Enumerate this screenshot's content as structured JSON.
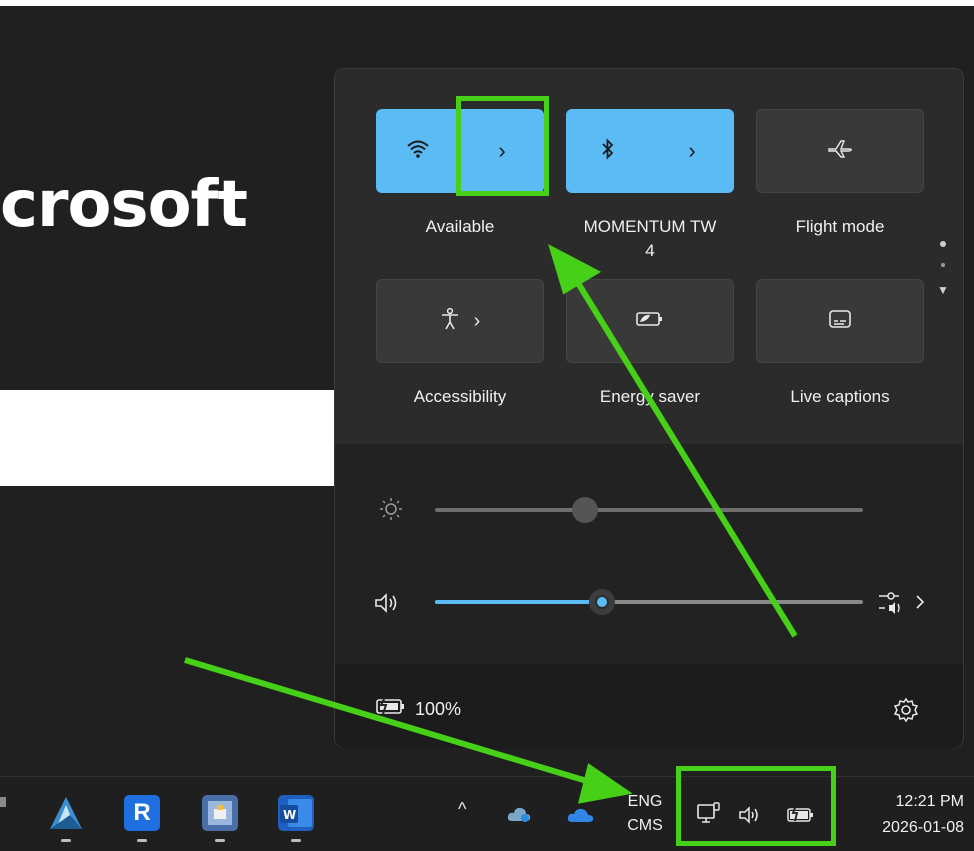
{
  "background": {
    "partial_title": "crosoft"
  },
  "quick_settings": {
    "tiles": [
      {
        "label": "Available",
        "icon": "wifi-icon",
        "state": "on",
        "has_chevron": true
      },
      {
        "label": "MOMENTUM TW\n4",
        "icon": "bluetooth-icon",
        "state": "on",
        "has_chevron": true
      },
      {
        "label": "Flight mode",
        "icon": "airplane-icon",
        "state": "off",
        "has_chevron": false
      },
      {
        "label": "Accessibility",
        "icon": "accessibility-icon",
        "state": "off",
        "has_chevron": true
      },
      {
        "label": "Energy saver",
        "icon": "energy-saver-icon",
        "state": "off",
        "has_chevron": false
      },
      {
        "label": "Live captions",
        "icon": "live-captions-icon",
        "state": "off",
        "has_chevron": false
      }
    ],
    "brightness": {
      "icon": "brightness-icon",
      "level": 0.35
    },
    "volume": {
      "icon": "speaker-icon",
      "level": 0.39,
      "mixer_icon": "audio-mixer-icon"
    },
    "battery": {
      "icon": "battery-charging-icon",
      "text": "100%"
    },
    "settings_icon": "gear-icon"
  },
  "taskbar": {
    "apps": [
      "arc-app-icon",
      "r-app-icon",
      "files-app-icon",
      "word-app-icon"
    ],
    "tray": {
      "language_line1": "ENG",
      "language_line2": "CMS",
      "time": "12:21 PM",
      "date": "2026-01-08"
    }
  },
  "colors": {
    "accent": "#5bbbf4",
    "annotation": "#46d017",
    "panel": "#2b2b2b"
  }
}
